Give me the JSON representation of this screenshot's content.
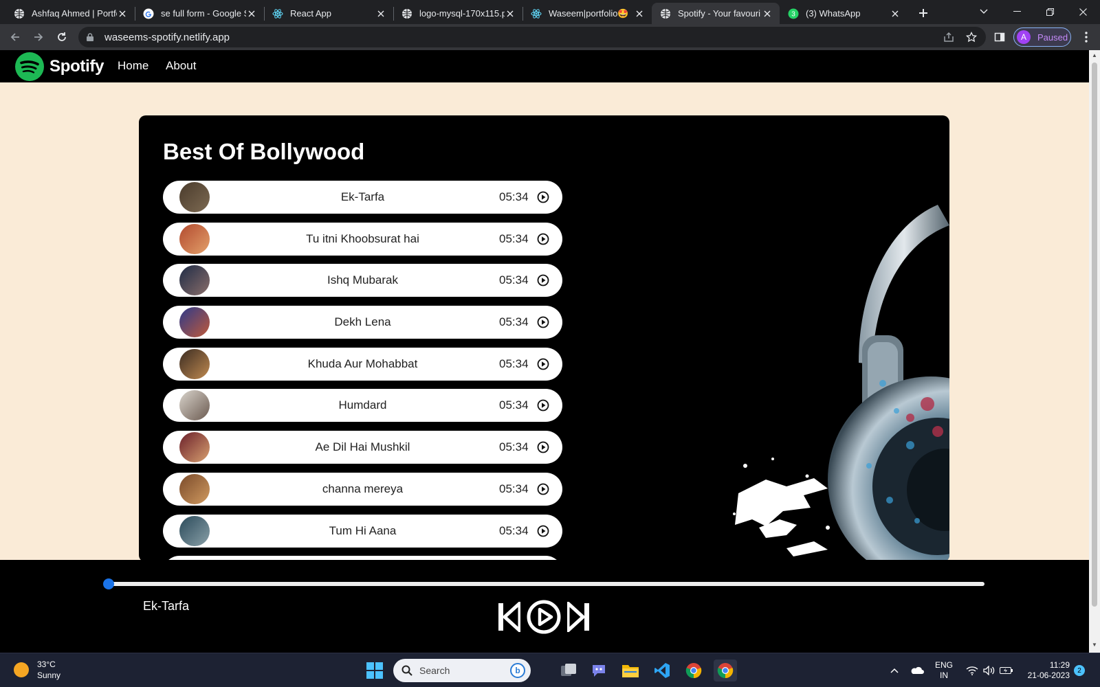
{
  "browser": {
    "tabs": [
      {
        "title": "Ashfaq Ahmed | Portfo",
        "icon": "globe-icon"
      },
      {
        "title": "se full form - Google S",
        "icon": "google-icon"
      },
      {
        "title": "React App",
        "icon": "react-icon"
      },
      {
        "title": "logo-mysql-170x115.p",
        "icon": "globe-icon"
      },
      {
        "title": "Waseem|portfolio🤩",
        "icon": "react-icon"
      },
      {
        "title": "Spotify - Your favouri",
        "icon": "globe-icon",
        "active": true
      },
      {
        "title": "(3) WhatsApp",
        "icon": "whatsapp-icon"
      }
    ],
    "url": "waseems-spotify.netlify.app",
    "profile": {
      "initial": "A",
      "status": "Paused"
    }
  },
  "site": {
    "brand": "Spotify",
    "nav": {
      "home": "Home",
      "about": "About"
    },
    "brand_color": "#1db954"
  },
  "playlist": {
    "title": "Best Of Bollywood",
    "songs": [
      {
        "name": "Ek-Tarfa",
        "duration": "05:34",
        "cover": [
          "#4a3b2c",
          "#7d6a52"
        ]
      },
      {
        "name": "Tu itni Khoobsurat hai",
        "duration": "05:34",
        "cover": [
          "#b24a2f",
          "#e3a06a"
        ]
      },
      {
        "name": "Ishq Mubarak",
        "duration": "05:34",
        "cover": [
          "#1e2b46",
          "#8a6e6a"
        ]
      },
      {
        "name": "Dekh Lena",
        "duration": "05:34",
        "cover": [
          "#2d3a8a",
          "#c05a3a"
        ]
      },
      {
        "name": "Khuda Aur Mohabbat",
        "duration": "05:34",
        "cover": [
          "#3b2c22",
          "#c08a50"
        ]
      },
      {
        "name": "Humdard",
        "duration": "05:34",
        "cover": [
          "#d9d4cc",
          "#6b5a50"
        ]
      },
      {
        "name": "Ae Dil Hai Mushkil",
        "duration": "05:34",
        "cover": [
          "#6a1f2a",
          "#d8a070"
        ]
      },
      {
        "name": "channa mereya",
        "duration": "05:34",
        "cover": [
          "#7a4a2a",
          "#d09a60"
        ]
      },
      {
        "name": "Tum Hi Aana",
        "duration": "05:34",
        "cover": [
          "#2a4a5a",
          "#8aa0a8"
        ]
      }
    ]
  },
  "player": {
    "now_playing": "Ek-Tarfa",
    "progress": 0,
    "accent": "#1a73e8"
  },
  "taskbar": {
    "weather": {
      "temp": "33°C",
      "condition": "Sunny"
    },
    "search_placeholder": "Search",
    "lang_top": "ENG",
    "lang_bottom": "IN",
    "time": "11:29",
    "date": "21-06-2023",
    "notifications": "2"
  }
}
